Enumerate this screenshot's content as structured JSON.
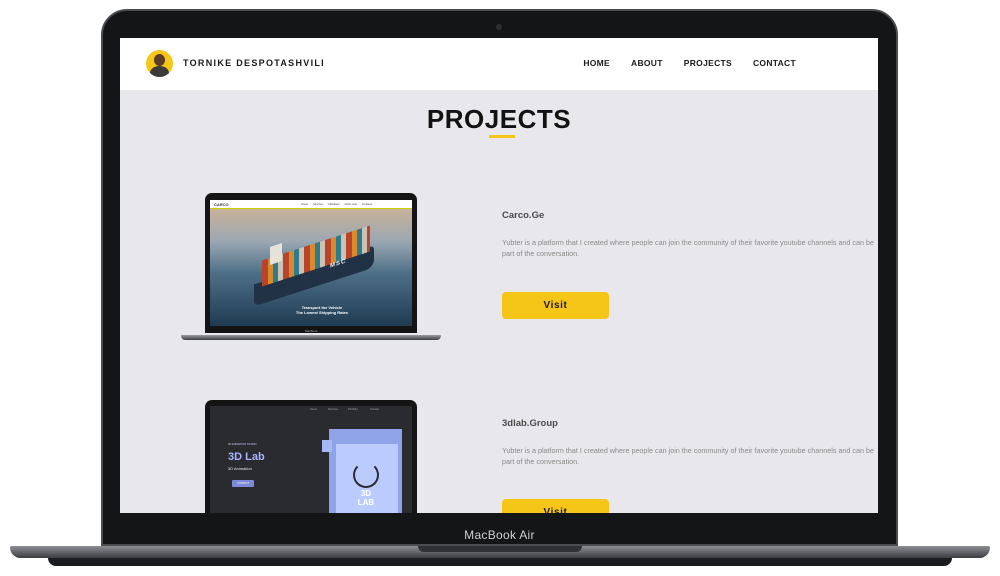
{
  "device": {
    "label": "MacBook Air"
  },
  "header": {
    "brand": "TORNIKE DESPOTASHVILI",
    "nav": [
      {
        "label": "HOME"
      },
      {
        "label": "ABOUT"
      },
      {
        "label": "PROJECTS"
      },
      {
        "label": "CONTACT"
      }
    ]
  },
  "page": {
    "title": "PROJECTS"
  },
  "projects": [
    {
      "title": "Carco.Ge",
      "description": "Yubter is a platform that I created where people can join the community of their favorite youtube channels and can be part of the conversation.",
      "button": "Visit",
      "mockup": {
        "logo": "CARCO",
        "nav_links": [
          "Home",
          "Services",
          "Calculator",
          "Order now",
          "Contacts"
        ],
        "ship_name": "MSC",
        "slogan_line1": "Transport the Vehicle",
        "slogan_line2": "The Lowest Shipping Rates",
        "device_label": "MacBook Air"
      }
    },
    {
      "title": "3dlab.Group",
      "description": "Yubter is a platform that I created where people can join the community of their favorite youtube channels and can be part of the conversation.",
      "button": "Visit",
      "mockup": {
        "kicker": "3D ANIMATION STUDIO",
        "title": "3D Lab",
        "subtitle": "3D Animation",
        "cta": "CONTACT",
        "logo_line1": "3D",
        "logo_line2": "LAB",
        "nav_links": [
          "Home",
          "Services",
          "Portfolio",
          "Contact"
        ]
      }
    }
  ],
  "colors": {
    "accent": "#f5c518",
    "page_background": "#e8e7eb",
    "header_background": "#ffffff",
    "title_text": "#121212"
  }
}
